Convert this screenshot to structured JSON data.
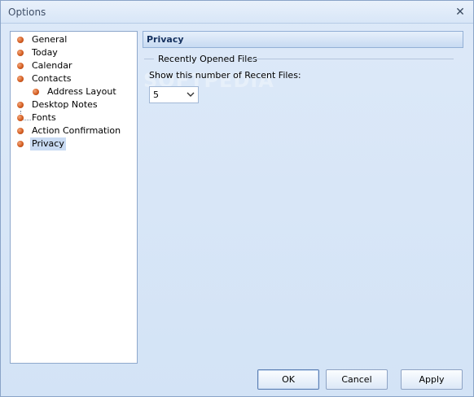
{
  "window": {
    "title": "Options",
    "close_glyph": "✕"
  },
  "tree": {
    "items": [
      {
        "label": "General",
        "indent": 0
      },
      {
        "label": "Today",
        "indent": 0
      },
      {
        "label": "Calendar",
        "indent": 0
      },
      {
        "label": "Contacts",
        "indent": 0
      },
      {
        "label": "Address Layout",
        "indent": 1
      },
      {
        "label": "Desktop Notes",
        "indent": 0
      },
      {
        "label": "Fonts",
        "indent": 0
      },
      {
        "label": "Action Confirmation",
        "indent": 0
      },
      {
        "label": "Privacy",
        "indent": 0,
        "selected": true
      }
    ]
  },
  "panel": {
    "header": "Privacy",
    "group_title": "Recently Opened Files",
    "field_label": "Show this number of Recent Files:",
    "recent_files_count": "5"
  },
  "buttons": {
    "ok": "OK",
    "cancel": "Cancel",
    "apply": "Apply"
  },
  "watermark": "SOFTPEDIA",
  "colors": {
    "accent": "#14305e",
    "bullet": "#d45e22",
    "selection": "#c9dbf3"
  }
}
